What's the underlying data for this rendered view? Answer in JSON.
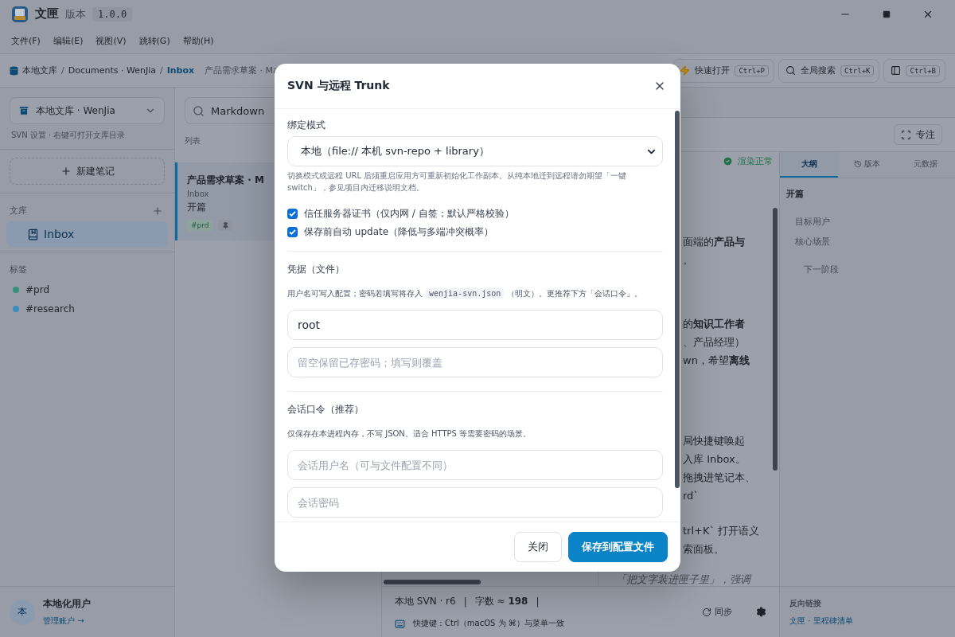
{
  "window": {
    "title": "文匣",
    "version_label": "版本",
    "version": "1.0.0"
  },
  "menu": [
    "文件(F)",
    "编辑(E)",
    "视图(V)",
    "跳转(G)",
    "帮助(H)"
  ],
  "breadcrumb": {
    "separator": "/",
    "items": [
      {
        "label": "本地文库",
        "current": false
      },
      {
        "label": "Documents · WenJia",
        "current": false
      },
      {
        "label": "Inbox",
        "current": true
      }
    ],
    "note": "产品需求草案 · Ma"
  },
  "toolbar_buttons": [
    {
      "kind": "quick",
      "label": "快速打开",
      "shortcut": "Ctrl+P"
    },
    {
      "kind": "search",
      "label": "全局搜索",
      "shortcut": "Ctrl+K"
    },
    {
      "kind": "panel",
      "shortcut": "Ctrl+B"
    }
  ],
  "sidebar": {
    "vault": "本地文库 · WenJia",
    "vault_hint": "SVN 设置 · 右键可打开文库目录",
    "new_note": "新建笔记",
    "library": {
      "title": "文库",
      "items": [
        {
          "label": "Inbox",
          "selected": true
        }
      ]
    },
    "tags": {
      "title": "标签",
      "items": [
        {
          "label": "#prd",
          "color": "#35917a"
        },
        {
          "label": "#research",
          "color": "#3b8cbf"
        }
      ]
    },
    "user": {
      "avatar": "本",
      "name": "本地化用户",
      "link": "管理账户 →"
    }
  },
  "note_list": {
    "search_value": "Markdown",
    "heading": "列表",
    "notes": [
      {
        "title": "产品需求草案 · M",
        "folder": "Inbox",
        "excerpt": "开篇",
        "tag": "#prd",
        "pinned": true,
        "selected": true
      }
    ]
  },
  "workspace": {
    "focus_button": "专注",
    "render_status": "渲染正常",
    "preview_paragraphs": [
      [
        "面端的**产品与**",
        "。"
      ],
      [
        "的**知识工作者**",
        "、产品经理）",
        "wn，希望**离线**"
      ],
      [
        "局快捷键唤起",
        "入库 Inbox。",
        "拖拽进笔记本、",
        "rd`"
      ],
      [
        "trl+K` 打开语义",
        "索面板。"
      ]
    ],
    "preview_quote": "「把文字装进匣子里」，强调",
    "status": {
      "revision": "本地 SVN · r6",
      "separator": "|",
      "word_count": "字数 ≈ **198**",
      "shortcut_hint": "快捷键：Ctrl（macOS 为 ⌘）与菜单一致",
      "sync": "同步"
    }
  },
  "right_panel": {
    "tabs": [
      {
        "label": "大纲",
        "kind": "plain",
        "selected": true
      },
      {
        "label": "版本",
        "kind": "history",
        "selected": false
      },
      {
        "label": "元数据",
        "kind": "plain",
        "selected": false
      }
    ],
    "outline": [
      {
        "label": "开篇",
        "children": [
          {
            "label": "目标用户"
          },
          {
            "label": "核心场景",
            "children": [
              {
                "label": "下一阶段"
              }
            ]
          }
        ]
      }
    ],
    "backlinks": {
      "title": "反向链接",
      "items": [
        "文匣 · 里程碑清单"
      ]
    }
  },
  "dialog": {
    "title": "SVN 与远程 Trunk",
    "mode": {
      "label": "绑定模式",
      "value": "本地（file:// 本机 svn-repo + library）",
      "hint": "切换模式或远程 URL 后须重启应用方可重新初始化工作副本。从纯本地迁到远程请勿期望「一键 switch」，参见项目内迁移说明文档。"
    },
    "options": [
      {
        "label": "信任服务器证书（仅内网 / 自签；默认严格校验）",
        "checked": true
      },
      {
        "label": "保存前自动 update（降低与多端冲突概率）",
        "checked": true
      }
    ],
    "credentials": {
      "title": "凭据（文件）",
      "note_before": "用户名可写入配置；密码若填写将存入",
      "note_code": "wenjia-svn.json",
      "note_after": "（明文）。更推荐下方「会话口令」。",
      "username": "root",
      "password_placeholder": "留空保留已存密码；填写则覆盖"
    },
    "session": {
      "title": "会话口令（推荐）",
      "note": "仅保存在本进程内存，不写 JSON。适合 HTTPS 等需要密码的场景。",
      "username_placeholder": "会话用户名（可与文件配置不同）",
      "password_placeholder": "会话密码"
    },
    "buttons": [
      {
        "label": "关闭",
        "kind": "secondary"
      },
      {
        "label": "保存到配置文件",
        "kind": "primary"
      }
    ]
  }
}
